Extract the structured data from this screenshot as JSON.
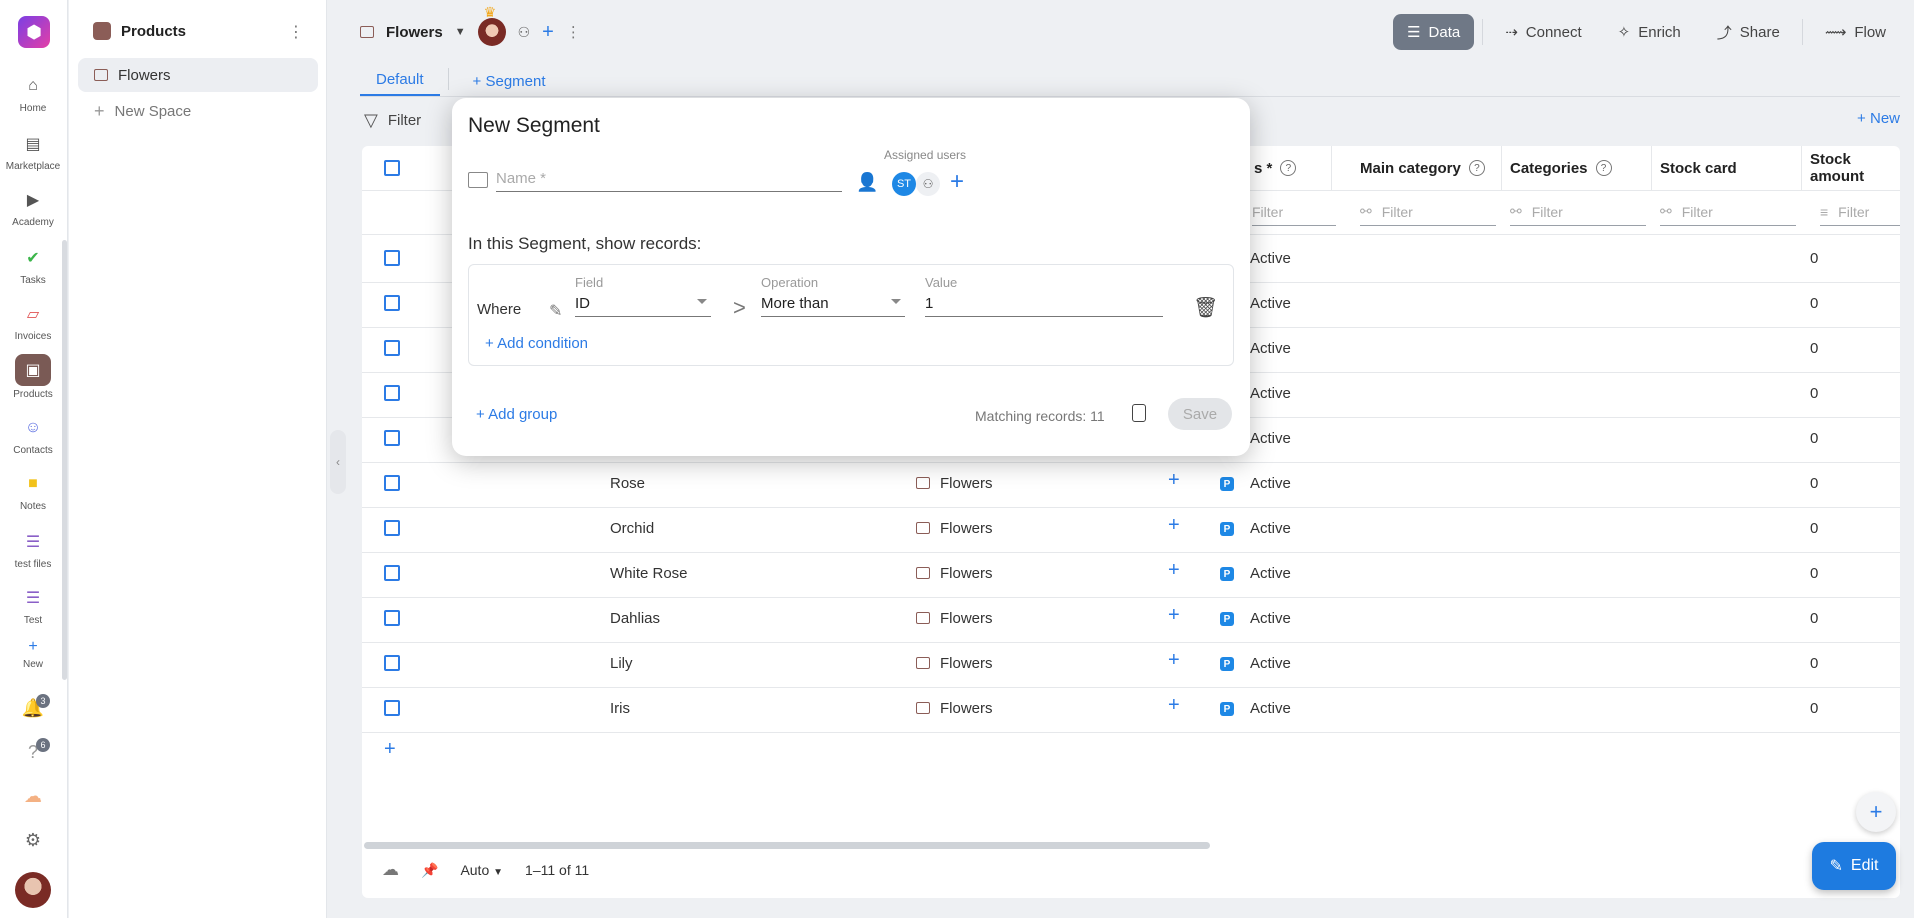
{
  "rail": {
    "items": [
      {
        "label": "Home",
        "icon": "home-icon"
      },
      {
        "label": "Marketplace",
        "icon": "store-icon"
      },
      {
        "label": "Academy",
        "icon": "play-icon"
      },
      {
        "label": "Tasks",
        "icon": "check-icon"
      },
      {
        "label": "Invoices",
        "icon": "invoice-icon"
      },
      {
        "label": "Products",
        "icon": "box-icon"
      },
      {
        "label": "Contacts",
        "icon": "contacts-icon"
      },
      {
        "label": "Notes",
        "icon": "note-icon"
      },
      {
        "label": "test files",
        "icon": "database-icon"
      },
      {
        "label": "Test",
        "icon": "database-icon"
      },
      {
        "label": "New",
        "icon": "plus-icon"
      }
    ],
    "notifications_count": "3",
    "help_count": "6"
  },
  "spaces": {
    "title": "Products",
    "items": [
      {
        "label": "Flowers"
      },
      {
        "label": "New Space"
      }
    ]
  },
  "topbar": {
    "title": "Flowers",
    "actions": [
      "Data",
      "Connect",
      "Enrich",
      "Share",
      "Flow"
    ]
  },
  "tabs": [
    "Default",
    "Segment"
  ],
  "toolbar": {
    "filter_label": "Filter",
    "new_label": "New"
  },
  "table": {
    "columns": [
      "s *",
      "Main category",
      "Categories",
      "Stock card",
      "Stock amount"
    ],
    "filter_placeholder": "Filter",
    "rows": [
      {
        "name": "",
        "space": "",
        "status": "Active",
        "stock": "0"
      },
      {
        "name": "",
        "space": "",
        "status": "Active",
        "stock": "0"
      },
      {
        "name": "",
        "space": "",
        "status": "Active",
        "stock": "0"
      },
      {
        "name": "",
        "space": "",
        "status": "Active",
        "stock": "0"
      },
      {
        "name": "",
        "space": "",
        "status": "Active",
        "stock": "0"
      },
      {
        "name": "Rose",
        "space": "Flowers",
        "status": "Active",
        "stock": "0"
      },
      {
        "name": "Orchid",
        "space": "Flowers",
        "status": "Active",
        "stock": "0"
      },
      {
        "name": "White Rose",
        "space": "Flowers",
        "status": "Active",
        "stock": "0"
      },
      {
        "name": "Dahlias",
        "space": "Flowers",
        "status": "Active",
        "stock": "0"
      },
      {
        "name": "Lily",
        "space": "Flowers",
        "status": "Active",
        "stock": "0"
      },
      {
        "name": "Iris",
        "space": "Flowers",
        "status": "Active",
        "stock": "0"
      }
    ]
  },
  "footer": {
    "row_height": "Auto",
    "pagination": "1–11 of 11"
  },
  "fab": {
    "edit_label": "Edit"
  },
  "modal": {
    "title": "New Segment",
    "name_placeholder": "Name *",
    "assigned_label": "Assigned users",
    "assigned_initials": "ST",
    "show_records": "In this Segment, show records:",
    "where": "Where",
    "field_label": "Field",
    "field_value": "ID",
    "operation_label": "Operation",
    "operation_value": "More than",
    "value_label": "Value",
    "value_value": "1",
    "add_condition": "Add condition",
    "add_group": "Add group",
    "matching": "Matching records: 11",
    "save": "Save"
  },
  "colors": {
    "accent": "#2c7be5",
    "product_brown": "#8b5d57",
    "active_top": "#6f7886"
  }
}
